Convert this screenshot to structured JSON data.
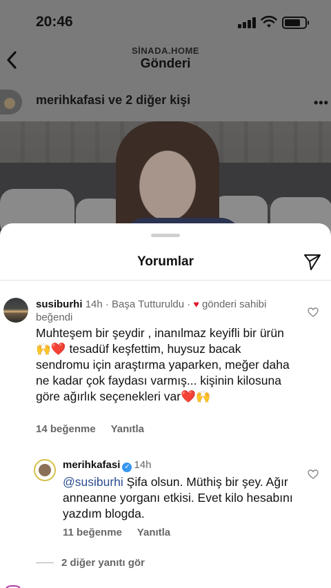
{
  "status_bar": {
    "time": "20:46"
  },
  "header": {
    "account": "SİNADA.HOME",
    "title": "Gönderi"
  },
  "post": {
    "users_text": "merihkafasi ve 2 diğer kişi",
    "more": "•••"
  },
  "sheet": {
    "title": "Yorumlar"
  },
  "comment": {
    "username": "susiburhi",
    "meta": "14h · Başa Tutturuldu ·",
    "heart": "♥",
    "liked_by_author": "gönderi sahibi beğendi",
    "text": "Muhteşem bir şeydir , inanılmaz keyifli bir ürün 🙌❤️ tesadüf keşfettim, huysuz bacak sendromu için araştırma yaparken, meğer daha ne kadar çok faydası varmış... kişinin kilosuna göre ağırlık seçenekleri var❤️🙌",
    "likes": "14 beğenme",
    "reply": "Yanıtla"
  },
  "reply_comment": {
    "username": "merihkafasi",
    "verified": "✓",
    "time": "14h",
    "mention": "@susiburhi",
    "text": " Şifa olsun. Müthiş bir şey. Ağır anneanne yorganı etkisi. Evet kilo hesabını yazdım blogda.",
    "likes": "11 beğenme",
    "reply": "Yanıtla"
  },
  "view_more": "2 diğer yanıtı gör",
  "colors": {
    "heart": "#e0152c",
    "mention": "#2b4d8f",
    "verified": "#3797f0"
  }
}
